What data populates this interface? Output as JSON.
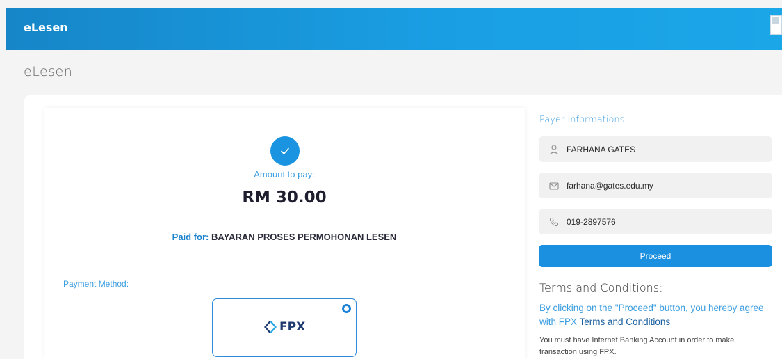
{
  "header": {
    "brand": "eLesen",
    "avatar_icon": "broken-image-icon"
  },
  "page": {
    "title": "eLesen"
  },
  "summary": {
    "check_icon": "check-icon",
    "amount_label": "Amount to pay:",
    "amount_value": "RM 30.00",
    "paid_for_label": "Paid for:",
    "paid_for_value": "BAYARAN PROSES PERMOHONAN LESEN"
  },
  "payment": {
    "label": "Payment Method:",
    "option_logo_text": "FPX",
    "selected": true
  },
  "payer": {
    "heading": "Payer Informations:",
    "name": "FARHANA GATES",
    "email": "farhana@gates.edu.my",
    "phone": "019-2897576",
    "name_icon": "user-icon",
    "email_icon": "envelope-icon",
    "phone_icon": "phone-icon"
  },
  "actions": {
    "proceed_label": "Proceed"
  },
  "terms": {
    "heading": "Terms and Conditions:",
    "text_before": "By clicking on the \"Proceed\" button, you hereby agree with FPX ",
    "link_label": "Terms and Conditions",
    "note": "You must have Internet Banking Account in order to make transaction using FPX."
  },
  "colors": {
    "accent": "#1b8fe0",
    "header_blue": "#1a9ee3",
    "link_blue": "#3d9ee0",
    "fpx_navy": "#1e3a70"
  }
}
